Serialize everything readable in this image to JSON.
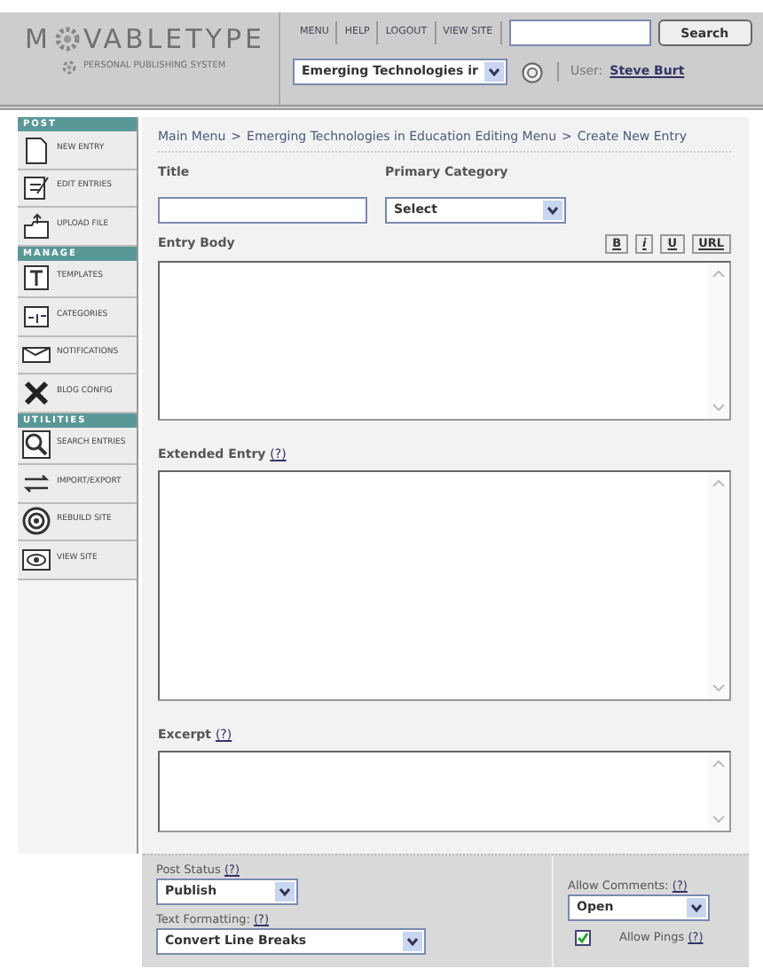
{
  "header": {
    "logo": {
      "left": "M",
      "right": "VABLETYPE",
      "subtitle": "PERSONAL PUBLISHING SYSTEM"
    },
    "nav_links": [
      "MENU",
      "HELP",
      "LOGOUT",
      "VIEW SITE"
    ],
    "search": {
      "button": "Search"
    },
    "blog_select": {
      "value": "Emerging Technologies ir"
    },
    "user": {
      "label": "User:",
      "name": "Steve Burt"
    }
  },
  "sidebar": {
    "sections": [
      {
        "title": "POST",
        "items": [
          {
            "label": "NEW ENTRY"
          },
          {
            "label": "EDIT ENTRIES"
          },
          {
            "label": "UPLOAD FILE"
          }
        ]
      },
      {
        "title": "MANAGE",
        "items": [
          {
            "label": "TEMPLATES"
          },
          {
            "label": "CATEGORIES"
          },
          {
            "label": "NOTIFICATIONS"
          },
          {
            "label": "BLOG CONFIG"
          }
        ]
      },
      {
        "title": "UTILITIES",
        "items": [
          {
            "label": "SEARCH ENTRIES"
          },
          {
            "label": "IMPORT/EXPORT"
          },
          {
            "label": "REBUILD SITE"
          },
          {
            "label": "VIEW SITE"
          }
        ]
      }
    ]
  },
  "breadcrumb": {
    "separator": ">",
    "items": [
      "Main Menu",
      "Emerging Technologies in Education Editing Menu",
      "Create New Entry"
    ]
  },
  "form": {
    "title_label": "Title",
    "category_label": "Primary Category",
    "category_value": "Select",
    "body_label": "Entry Body",
    "format_buttons": [
      "B",
      "i",
      "U",
      "URL"
    ],
    "extended_label": "Extended Entry",
    "excerpt_label": "Excerpt",
    "help": "(?)"
  },
  "options": {
    "post_status": {
      "label": "Post Status",
      "value": "Publish"
    },
    "text_formatting": {
      "label": "Text Formatting:",
      "value": "Convert Line Breaks"
    },
    "allow_comments": {
      "label": "Allow Comments:",
      "value": "Open"
    },
    "allow_pings": {
      "label": "Allow Pings",
      "checked": true
    }
  }
}
